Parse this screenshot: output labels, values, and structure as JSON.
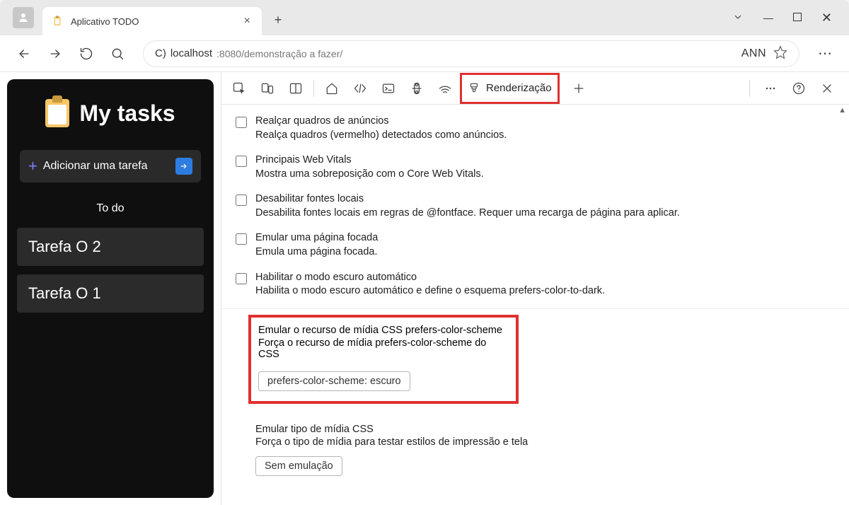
{
  "browser_tab": {
    "title": "Aplicativo TODO"
  },
  "address_bar": {
    "prefix": "C) ",
    "host": "localhost",
    "path": ":8080/demonstração a fazer/",
    "profile": "ANN"
  },
  "app": {
    "title": "My tasks",
    "add_label": "Adicionar uma tarefa",
    "list_header": "To do",
    "tasks": [
      "Tarefa O 2",
      "Tarefa O 1"
    ]
  },
  "devtools": {
    "active_tab": "Renderização",
    "options": [
      {
        "title": "Realçar quadros de anúncios",
        "desc": "Realça quadros (vermelho) detectados como anúncios."
      },
      {
        "title": "Principais Web Vitals",
        "desc": "Mostra uma sobreposição com o Core Web Vitals."
      },
      {
        "title": "Desabilitar fontes locais",
        "desc": "Desabilita fontes locais em regras de @fontface. Requer uma recarga de página para aplicar."
      },
      {
        "title": "Emular uma página focada",
        "desc": "Emula uma página focada."
      },
      {
        "title": "Habilitar o modo escuro automático",
        "desc": "Habilita o modo escuro automático e define o esquema prefers-color-to-dark."
      }
    ],
    "color_scheme": {
      "title": "Emular o recurso de mídia CSS prefers-color-scheme",
      "desc": "Força o recurso de mídia prefers-color-scheme do CSS",
      "value": "prefers-color-scheme: escuro"
    },
    "media_type": {
      "title": "Emular tipo de mídia CSS",
      "desc": "Força o tipo de mídia para testar estilos de impressão e tela",
      "value": "Sem emulação"
    }
  }
}
